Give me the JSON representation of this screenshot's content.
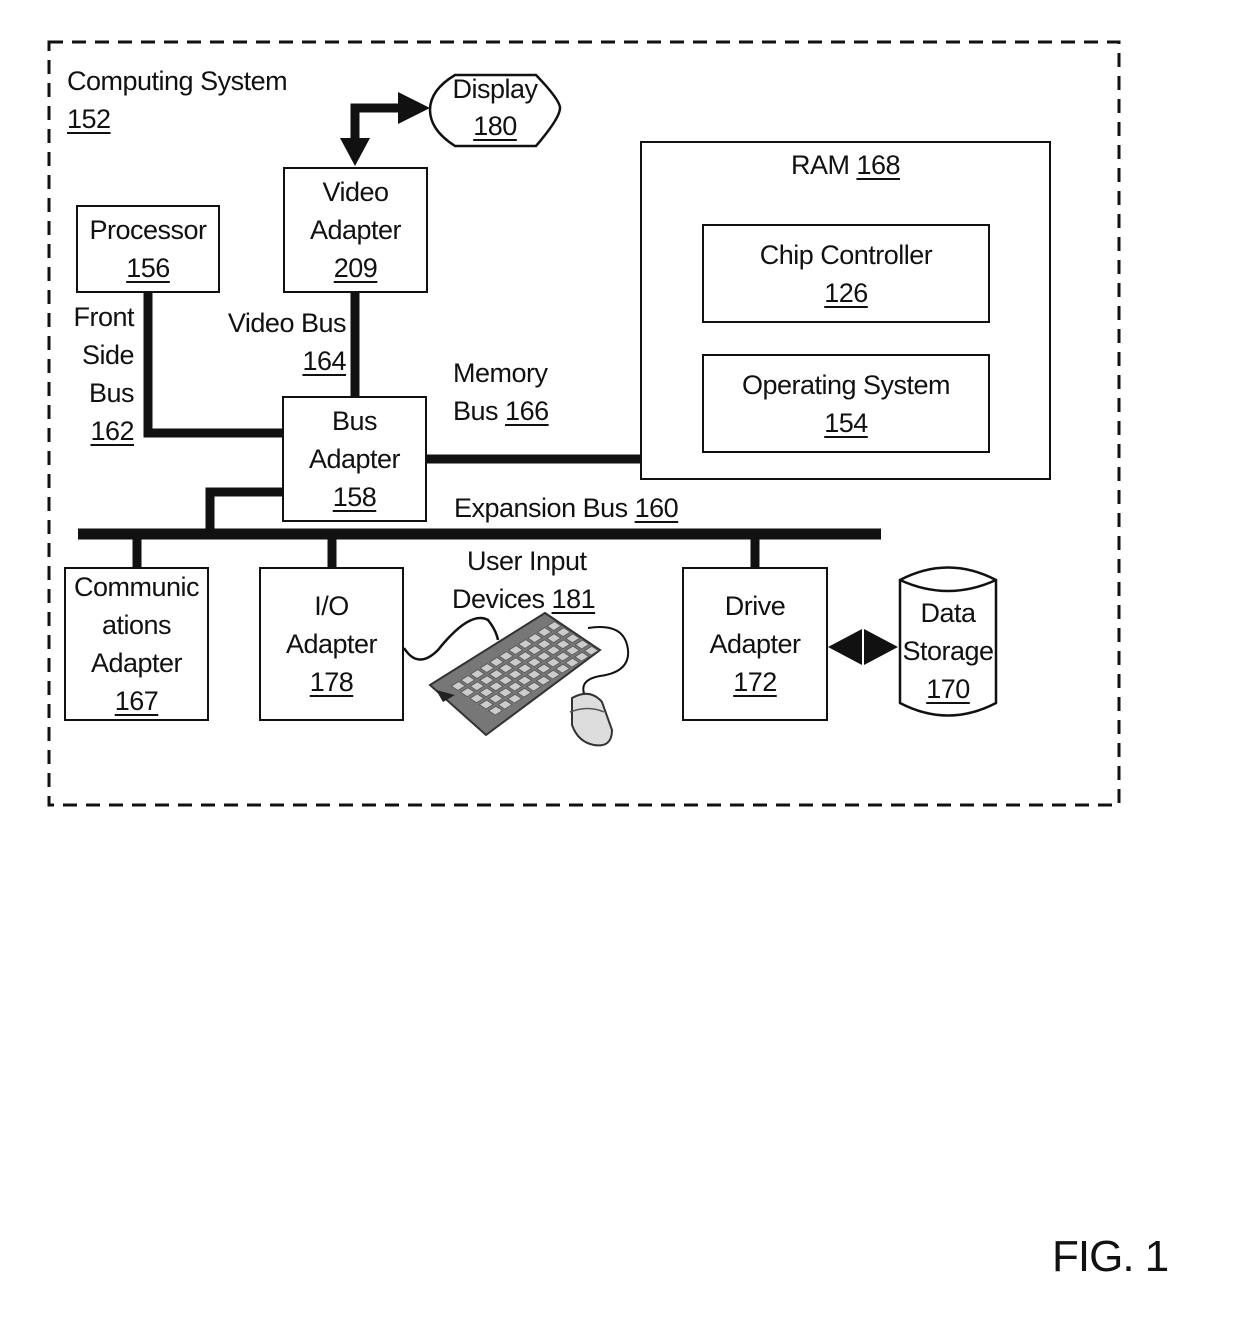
{
  "figure_label": "FIG. 1",
  "system": {
    "title": "Computing System",
    "ref": "152"
  },
  "components": {
    "display": {
      "name": "Display",
      "ref": "180"
    },
    "video_adapter": {
      "line1": "Video",
      "line2": "Adapter",
      "ref": "209"
    },
    "processor": {
      "name": "Processor",
      "ref": "156"
    },
    "bus_adapter": {
      "line1": "Bus",
      "line2": "Adapter",
      "ref": "158"
    },
    "ram": {
      "name": "RAM",
      "ref": "168"
    },
    "chip_controller": {
      "name": "Chip Controller",
      "ref": "126"
    },
    "operating_system": {
      "name": "Operating System",
      "ref": "154"
    },
    "communications_adapter": {
      "line1": "Communic",
      "line2": "ations",
      "line3": "Adapter",
      "ref": "167"
    },
    "io_adapter": {
      "line1": "I/O",
      "line2": "Adapter",
      "ref": "178"
    },
    "user_input_devices": {
      "line1": "User Input",
      "line2": "Devices",
      "ref": "181"
    },
    "drive_adapter": {
      "line1": "Drive",
      "line2": "Adapter",
      "ref": "172"
    },
    "data_storage": {
      "line1": "Data",
      "line2": "Storage",
      "ref": "170"
    }
  },
  "buses": {
    "front_side_bus": {
      "line1": "Front",
      "line2": "Side",
      "line3": "Bus",
      "ref": "162"
    },
    "video_bus": {
      "name": "Video Bus",
      "ref": "164"
    },
    "memory_bus": {
      "line1": "Memory",
      "line2": "Bus",
      "ref": "166"
    },
    "expansion_bus": {
      "name": "Expansion Bus",
      "ref": "160"
    }
  }
}
